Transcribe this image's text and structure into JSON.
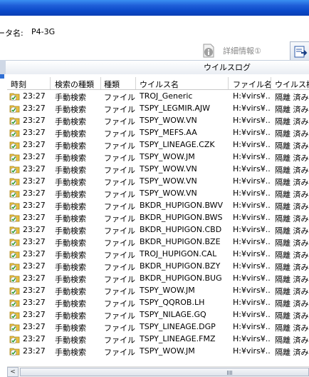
{
  "header": {
    "pcname_label": "ータ名:",
    "pcname_value": "P4-3G",
    "detail_button_label": "詳細情報①"
  },
  "panel": {
    "title": "ウイルスログ"
  },
  "table": {
    "columns": [
      "時刻",
      "検索の種類",
      "種類",
      "ウイルス名",
      "ファイル名",
      "ウイルス検"
    ],
    "rows": [
      {
        "time": "23:27",
        "scan_type": "手動検索",
        "kind": "ファイル",
        "virus": "TROJ_Generic",
        "file": "H:¥virs¥...",
        "result": "隔離 済み"
      },
      {
        "time": "23:27",
        "scan_type": "手動検索",
        "kind": "ファイル",
        "virus": "TSPY_LEGMIR.AJW",
        "file": "H:¥virs¥...",
        "result": "隔離 済み"
      },
      {
        "time": "23:27",
        "scan_type": "手動検索",
        "kind": "ファイル",
        "virus": "TSPY_WOW.VN",
        "file": "H:¥virs¥...",
        "result": "隔離 済み"
      },
      {
        "time": "23:27",
        "scan_type": "手動検索",
        "kind": "ファイル",
        "virus": "TSPY_MEFS.AA",
        "file": "H:¥virs¥...",
        "result": "隔離 済み"
      },
      {
        "time": "23:27",
        "scan_type": "手動検索",
        "kind": "ファイル",
        "virus": "TSPY_LINEAGE.CZK",
        "file": "H:¥virs¥...",
        "result": "隔離 済み"
      },
      {
        "time": "23:27",
        "scan_type": "手動検索",
        "kind": "ファイル",
        "virus": "TSPY_WOW.JM",
        "file": "H:¥virs¥...",
        "result": "隔離 済み"
      },
      {
        "time": "23:27",
        "scan_type": "手動検索",
        "kind": "ファイル",
        "virus": "TSPY_WOW.VN",
        "file": "H:¥virs¥...",
        "result": "隔離 済み"
      },
      {
        "time": "23:27",
        "scan_type": "手動検索",
        "kind": "ファイル",
        "virus": "TSPY_WOW.VN",
        "file": "H:¥virs¥...",
        "result": "隔離 済み"
      },
      {
        "time": "23:27",
        "scan_type": "手動検索",
        "kind": "ファイル",
        "virus": "TSPY_WOW.VN",
        "file": "H:¥virs¥...",
        "result": "隔離 済み"
      },
      {
        "time": "23:27",
        "scan_type": "手動検索",
        "kind": "ファイル",
        "virus": "BKDR_HUPIGON.BWV",
        "file": "H:¥virs¥...",
        "result": "隔離 済み"
      },
      {
        "time": "23:27",
        "scan_type": "手動検索",
        "kind": "ファイル",
        "virus": "BKDR_HUPIGON.BWS",
        "file": "H:¥virs¥...",
        "result": "隔離 済み"
      },
      {
        "time": "23:27",
        "scan_type": "手動検索",
        "kind": "ファイル",
        "virus": "BKDR_HUPIGON.CBD",
        "file": "H:¥virs¥...",
        "result": "隔離 済み"
      },
      {
        "time": "23:27",
        "scan_type": "手動検索",
        "kind": "ファイル",
        "virus": "BKDR_HUPIGON.BZE",
        "file": "H:¥virs¥...",
        "result": "隔離 済み"
      },
      {
        "time": "23:27",
        "scan_type": "手動検索",
        "kind": "ファイル",
        "virus": "TROJ_HUPIGON.CAL",
        "file": "H:¥virs¥...",
        "result": "隔離 済み"
      },
      {
        "time": "23:27",
        "scan_type": "手動検索",
        "kind": "ファイル",
        "virus": "BKDR_HUPIGON.BZY",
        "file": "H:¥virs¥...",
        "result": "隔離 済み"
      },
      {
        "time": "23:27",
        "scan_type": "手動検索",
        "kind": "ファイル",
        "virus": "BKDR_HUPIGON.BUG",
        "file": "H:¥virs¥...",
        "result": "隔離 済み"
      },
      {
        "time": "23:27",
        "scan_type": "手動検索",
        "kind": "ファイル",
        "virus": "TSPY_WOW.JM",
        "file": "H:¥virs¥...",
        "result": "隔離 済み"
      },
      {
        "time": "23:27",
        "scan_type": "手動検索",
        "kind": "ファイル",
        "virus": "TSPY_QQROB.LH",
        "file": "H:¥virs¥...",
        "result": "隔離 済み"
      },
      {
        "time": "23:27",
        "scan_type": "手動検索",
        "kind": "ファイル",
        "virus": "TSPY_NILAGE.GQ",
        "file": "H:¥virs¥...",
        "result": "隔離 済み"
      },
      {
        "time": "23:27",
        "scan_type": "手動検索",
        "kind": "ファイル",
        "virus": "TSPY_LINEAGE.DGP",
        "file": "H:¥virs¥...",
        "result": "隔離 済み"
      },
      {
        "time": "23:27",
        "scan_type": "手動検索",
        "kind": "ファイル",
        "virus": "TSPY_LINEAGE.FMZ",
        "file": "H:¥virs¥...",
        "result": "隔離 済み"
      },
      {
        "time": "23:27",
        "scan_type": "手動検索",
        "kind": "ファイル",
        "virus": "TSPY_WOW.JM",
        "file": "H:¥virs¥...",
        "result": "隔離 済み"
      }
    ]
  },
  "icons": {
    "row_status": "quarantined-folder-check-icon",
    "detail": "info-document-icon",
    "export": "export-icon"
  },
  "colors": {
    "titlebar": "#0a49c9",
    "check": "#2e9b2e",
    "folder": "#e8c040"
  }
}
